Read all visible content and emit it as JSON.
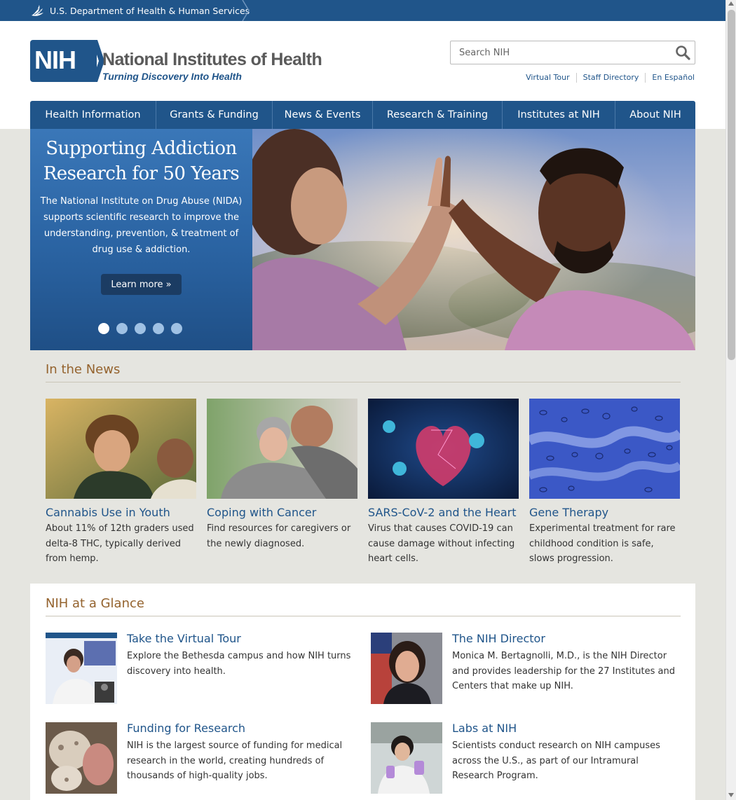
{
  "hhs": {
    "label": "U.S. Department of Health & Human Services"
  },
  "logo": {
    "abbr": "NIH",
    "title": "National Institutes of Health",
    "tagline": "Turning Discovery Into Health"
  },
  "search": {
    "placeholder": "Search NIH"
  },
  "utility_links": [
    "Virtual Tour",
    "Staff Directory",
    "En Español"
  ],
  "nav": [
    "Health Information",
    "Grants & Funding",
    "News & Events",
    "Research & Training",
    "Institutes at NIH",
    "About NIH"
  ],
  "hero": {
    "title": "Supporting Addiction Research for 50 Years",
    "body": "The National Institute on Drug Abuse (NIDA) supports scientific research to improve the understanding, prevention, & treatment of drug use & addiction.",
    "button": "Learn more »",
    "slide_count": 5,
    "active_slide": 1
  },
  "news": {
    "title": "In the News",
    "items": [
      {
        "title": "Cannabis Use in Youth",
        "desc": "About 11% of 12th graders used delta-8 THC, typically derived from hemp."
      },
      {
        "title": "Coping with Cancer",
        "desc": "Find resources for caregivers or the newly diagnosed."
      },
      {
        "title": "SARS-CoV-2 and the Heart",
        "desc": "Virus that causes COVID-19 can cause damage without infecting heart cells."
      },
      {
        "title": "Gene Therapy",
        "desc": "Experimental treatment for rare childhood condition is safe, slows progression."
      }
    ]
  },
  "glance": {
    "title": "NIH at a Glance",
    "items": [
      {
        "title": "Take the Virtual Tour",
        "desc": "Explore the Bethesda campus and how NIH turns discovery into health."
      },
      {
        "title": "The NIH Director",
        "desc": "Monica M. Bertagnolli, M.D., is the NIH Director and provides leadership for the 27 Institutes and Centers that make up NIH."
      },
      {
        "title": "Funding for Research",
        "desc": "NIH is the largest source of funding for medical research in the world, creating hundreds of thousands of high-quality jobs."
      },
      {
        "title": "Labs at NIH",
        "desc": "Scientists conduct research on NIH campuses across the U.S., as part of our Intramural Research Program."
      }
    ]
  },
  "colors": {
    "brand_blue": "#20558a",
    "section_title": "#94632e",
    "link": "#20558a"
  },
  "icons": {
    "hhs": "hhs-eagle-icon",
    "search": "search-icon"
  }
}
